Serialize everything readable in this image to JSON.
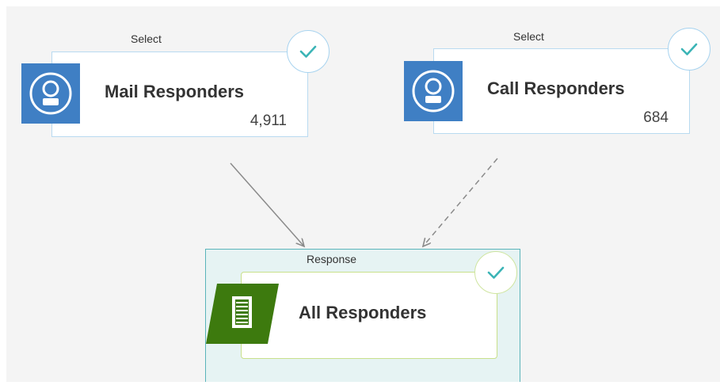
{
  "workflow": {
    "nodes": [
      {
        "type_label": "Select",
        "title": "Mail Responders",
        "count": "4,911",
        "status": "complete",
        "icon": "person-icon"
      },
      {
        "type_label": "Select",
        "title": "Call Responders",
        "count": "684",
        "status": "complete",
        "icon": "person-icon"
      },
      {
        "type_label": "Response",
        "title": "All Responders",
        "status": "complete",
        "icon": "document-icon"
      }
    ],
    "connections": [
      {
        "from": "Mail Responders",
        "to": "All Responders",
        "style": "solid"
      },
      {
        "from": "Call Responders",
        "to": "All Responders",
        "style": "dashed"
      }
    ]
  },
  "colors": {
    "canvas": "#f4f4f4",
    "select_icon_bg": "#3f7fc4",
    "response_icon_bg": "#3d7a0e",
    "check_color": "#3bb4b6",
    "select_card_border": "#b9daf0",
    "response_card_border": "#c8e08b",
    "response_container_bg": "#e6f3f3",
    "response_container_border": "#5ab4ba",
    "connector": "#8a8a8a"
  }
}
